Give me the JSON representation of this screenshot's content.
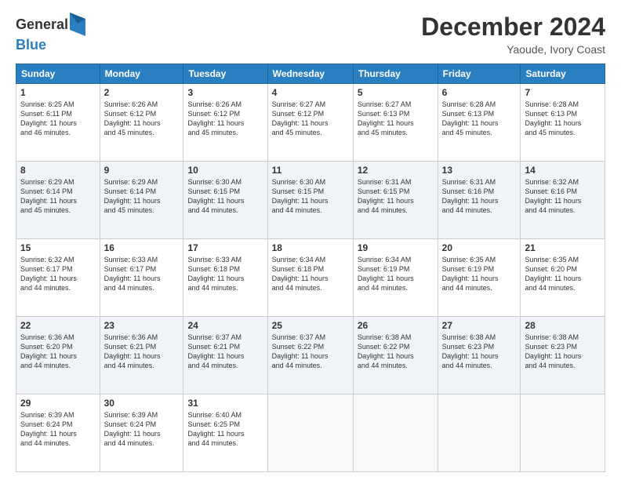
{
  "logo": {
    "general": "General",
    "blue": "Blue"
  },
  "title": {
    "main": "December 2024",
    "sub": "Yaoude, Ivory Coast"
  },
  "calendar": {
    "headers": [
      "Sunday",
      "Monday",
      "Tuesday",
      "Wednesday",
      "Thursday",
      "Friday",
      "Saturday"
    ],
    "rows": [
      [
        {
          "day": "1",
          "info": "Sunrise: 6:25 AM\nSunset: 6:11 PM\nDaylight: 11 hours\nand 46 minutes."
        },
        {
          "day": "2",
          "info": "Sunrise: 6:26 AM\nSunset: 6:12 PM\nDaylight: 11 hours\nand 45 minutes."
        },
        {
          "day": "3",
          "info": "Sunrise: 6:26 AM\nSunset: 6:12 PM\nDaylight: 11 hours\nand 45 minutes."
        },
        {
          "day": "4",
          "info": "Sunrise: 6:27 AM\nSunset: 6:12 PM\nDaylight: 11 hours\nand 45 minutes."
        },
        {
          "day": "5",
          "info": "Sunrise: 6:27 AM\nSunset: 6:13 PM\nDaylight: 11 hours\nand 45 minutes."
        },
        {
          "day": "6",
          "info": "Sunrise: 6:28 AM\nSunset: 6:13 PM\nDaylight: 11 hours\nand 45 minutes."
        },
        {
          "day": "7",
          "info": "Sunrise: 6:28 AM\nSunset: 6:13 PM\nDaylight: 11 hours\nand 45 minutes."
        }
      ],
      [
        {
          "day": "8",
          "info": "Sunrise: 6:29 AM\nSunset: 6:14 PM\nDaylight: 11 hours\nand 45 minutes."
        },
        {
          "day": "9",
          "info": "Sunrise: 6:29 AM\nSunset: 6:14 PM\nDaylight: 11 hours\nand 45 minutes."
        },
        {
          "day": "10",
          "info": "Sunrise: 6:30 AM\nSunset: 6:15 PM\nDaylight: 11 hours\nand 44 minutes."
        },
        {
          "day": "11",
          "info": "Sunrise: 6:30 AM\nSunset: 6:15 PM\nDaylight: 11 hours\nand 44 minutes."
        },
        {
          "day": "12",
          "info": "Sunrise: 6:31 AM\nSunset: 6:15 PM\nDaylight: 11 hours\nand 44 minutes."
        },
        {
          "day": "13",
          "info": "Sunrise: 6:31 AM\nSunset: 6:16 PM\nDaylight: 11 hours\nand 44 minutes."
        },
        {
          "day": "14",
          "info": "Sunrise: 6:32 AM\nSunset: 6:16 PM\nDaylight: 11 hours\nand 44 minutes."
        }
      ],
      [
        {
          "day": "15",
          "info": "Sunrise: 6:32 AM\nSunset: 6:17 PM\nDaylight: 11 hours\nand 44 minutes."
        },
        {
          "day": "16",
          "info": "Sunrise: 6:33 AM\nSunset: 6:17 PM\nDaylight: 11 hours\nand 44 minutes."
        },
        {
          "day": "17",
          "info": "Sunrise: 6:33 AM\nSunset: 6:18 PM\nDaylight: 11 hours\nand 44 minutes."
        },
        {
          "day": "18",
          "info": "Sunrise: 6:34 AM\nSunset: 6:18 PM\nDaylight: 11 hours\nand 44 minutes."
        },
        {
          "day": "19",
          "info": "Sunrise: 6:34 AM\nSunset: 6:19 PM\nDaylight: 11 hours\nand 44 minutes."
        },
        {
          "day": "20",
          "info": "Sunrise: 6:35 AM\nSunset: 6:19 PM\nDaylight: 11 hours\nand 44 minutes."
        },
        {
          "day": "21",
          "info": "Sunrise: 6:35 AM\nSunset: 6:20 PM\nDaylight: 11 hours\nand 44 minutes."
        }
      ],
      [
        {
          "day": "22",
          "info": "Sunrise: 6:36 AM\nSunset: 6:20 PM\nDaylight: 11 hours\nand 44 minutes."
        },
        {
          "day": "23",
          "info": "Sunrise: 6:36 AM\nSunset: 6:21 PM\nDaylight: 11 hours\nand 44 minutes."
        },
        {
          "day": "24",
          "info": "Sunrise: 6:37 AM\nSunset: 6:21 PM\nDaylight: 11 hours\nand 44 minutes."
        },
        {
          "day": "25",
          "info": "Sunrise: 6:37 AM\nSunset: 6:22 PM\nDaylight: 11 hours\nand 44 minutes."
        },
        {
          "day": "26",
          "info": "Sunrise: 6:38 AM\nSunset: 6:22 PM\nDaylight: 11 hours\nand 44 minutes."
        },
        {
          "day": "27",
          "info": "Sunrise: 6:38 AM\nSunset: 6:23 PM\nDaylight: 11 hours\nand 44 minutes."
        },
        {
          "day": "28",
          "info": "Sunrise: 6:38 AM\nSunset: 6:23 PM\nDaylight: 11 hours\nand 44 minutes."
        }
      ],
      [
        {
          "day": "29",
          "info": "Sunrise: 6:39 AM\nSunset: 6:24 PM\nDaylight: 11 hours\nand 44 minutes."
        },
        {
          "day": "30",
          "info": "Sunrise: 6:39 AM\nSunset: 6:24 PM\nDaylight: 11 hours\nand 44 minutes."
        },
        {
          "day": "31",
          "info": "Sunrise: 6:40 AM\nSunset: 6:25 PM\nDaylight: 11 hours\nand 44 minutes."
        },
        {
          "day": "",
          "info": ""
        },
        {
          "day": "",
          "info": ""
        },
        {
          "day": "",
          "info": ""
        },
        {
          "day": "",
          "info": ""
        }
      ]
    ]
  }
}
